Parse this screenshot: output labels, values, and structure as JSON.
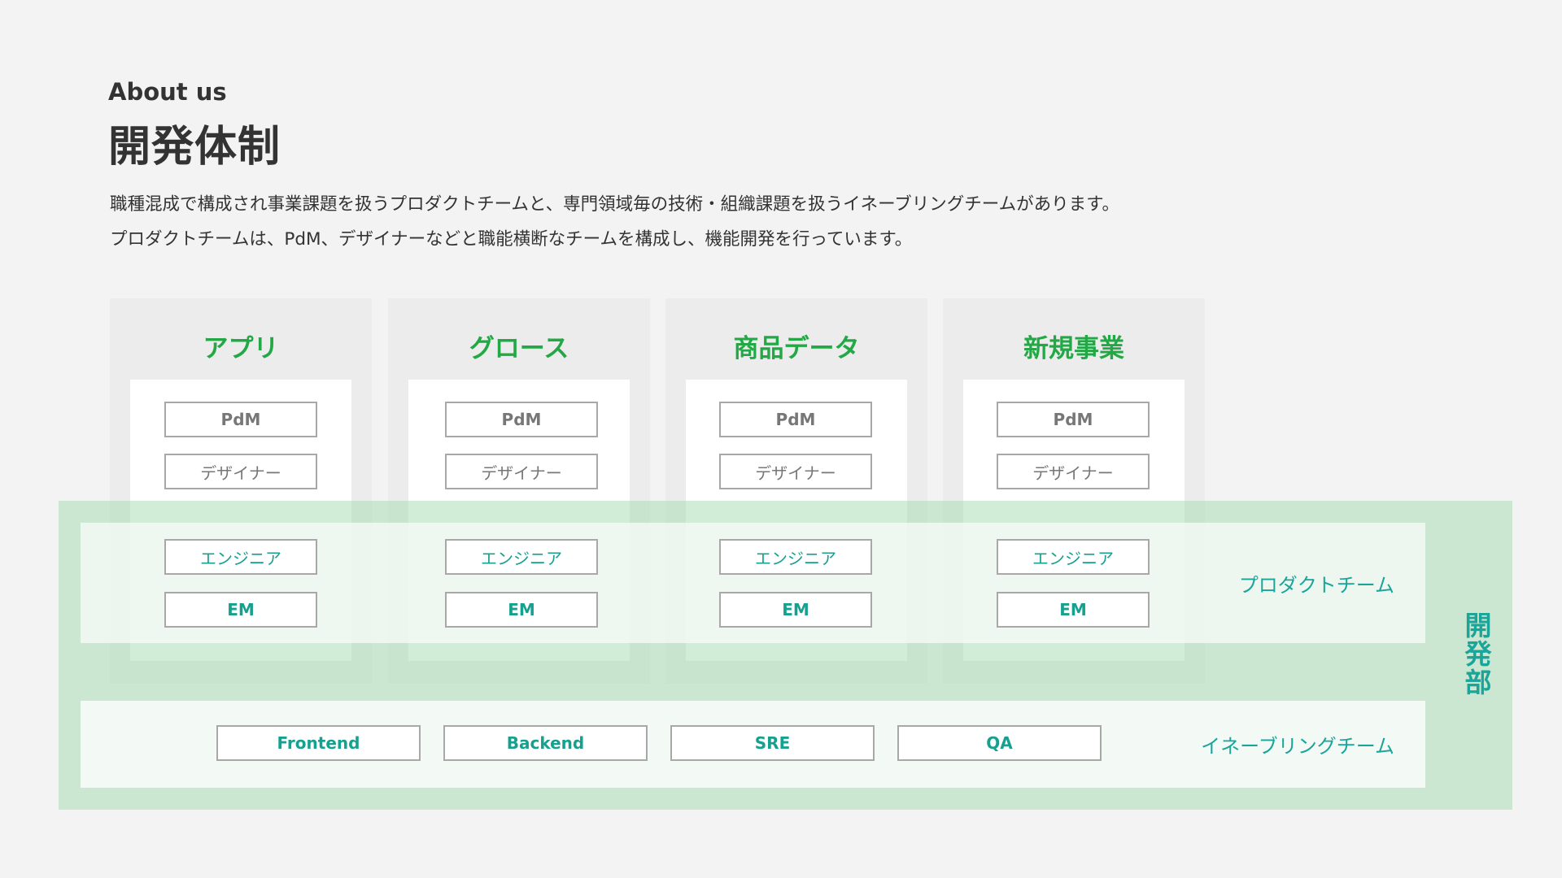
{
  "header": {
    "eyebrow": "About us",
    "title": "開発体制",
    "description_lines": [
      "職種混成で構成され事業課題を扱うプロダクトチームと、専門領域毎の技術・組織課題を扱うイネーブリングチームがあります。",
      "プロダクトチームは、PdM、デザイナーなどと職能横断なチームを構成し、機能開発を行っています。"
    ]
  },
  "product_teams": [
    {
      "name": "アプリ",
      "roles": [
        "PdM",
        "デザイナー",
        "エンジニア",
        "EM"
      ]
    },
    {
      "name": "グロース",
      "roles": [
        "PdM",
        "デザイナー",
        "エンジニア",
        "EM"
      ]
    },
    {
      "name": "商品データ",
      "roles": [
        "PdM",
        "デザイナー",
        "エンジニア",
        "EM"
      ]
    },
    {
      "name": "新規事業",
      "roles": [
        "PdM",
        "デザイナー",
        "エンジニア",
        "EM"
      ]
    }
  ],
  "labels": {
    "product_team": "プロダクトチーム",
    "enabling_team": "イネーブリングチーム",
    "department": "開発部"
  },
  "enabling_teams": [
    "Frontend",
    "Backend",
    "SRE",
    "QA"
  ],
  "colors": {
    "background": "#f3f3f3",
    "column": "#ececec",
    "accent_green": "#22a845",
    "accent_teal": "#1aa59b",
    "department_band": "#cde8d4",
    "box_border": "#a8a8a8"
  }
}
